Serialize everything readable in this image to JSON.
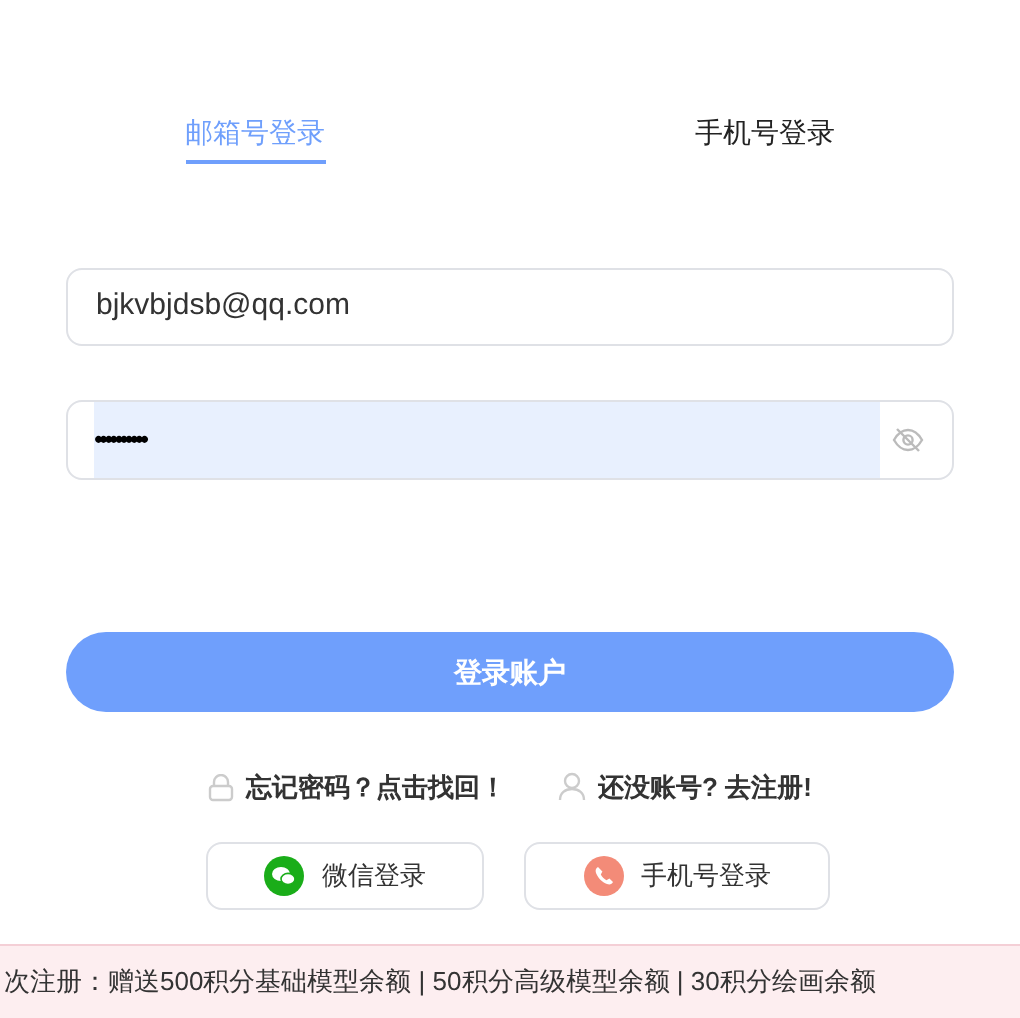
{
  "tabs": [
    {
      "label": "邮箱号登录",
      "selected": true
    },
    {
      "label": "手机号登录",
      "selected": false
    }
  ],
  "email_field": {
    "value": "bjkvbjdsb@qq.com"
  },
  "password_field": {
    "value": "••••••••••",
    "autofilled": true
  },
  "login_button": {
    "label": "登录账户"
  },
  "links": [
    {
      "kind": "lock",
      "label": "忘记密码？点击找回！"
    },
    {
      "kind": "user",
      "label": "还没账号? 去注册!"
    }
  ],
  "alt_logins": [
    {
      "kind": "wechat",
      "label": "微信登录"
    },
    {
      "kind": "phone",
      "label": "手机号登录"
    }
  ],
  "banner": {
    "text": "次注册：赠送500积分基础模型余额 | 50积分高级模型余额 | 30积分绘画余额"
  }
}
